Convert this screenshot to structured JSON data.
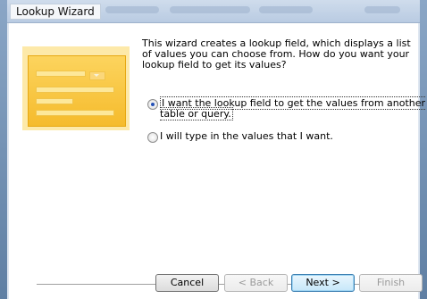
{
  "window": {
    "title": "Lookup Wizard"
  },
  "description": "This wizard creates a lookup field, which displays a list of values you can choose from.  How do you want your lookup field to get its values?",
  "options": [
    {
      "label": "I want the lookup field to get the values from another table or query.",
      "selected": true
    },
    {
      "label": "I will type in the values that I want.",
      "selected": false
    }
  ],
  "buttons": {
    "cancel": "Cancel",
    "back": "< Back",
    "next": "Next >",
    "finish": "Finish"
  },
  "colors": {
    "accent": "#2451b6",
    "illustration": "#f5bb2c"
  }
}
